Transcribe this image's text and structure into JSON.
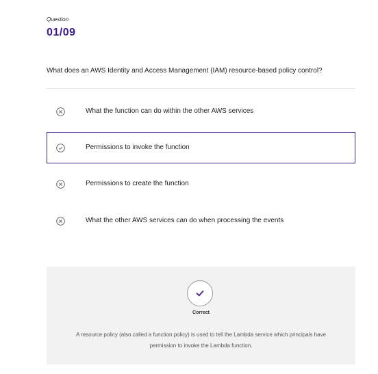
{
  "question": {
    "caption": "Question",
    "number": "01/09",
    "text": "What does an AWS Identity and Access Management (IAM) resource-based policy control?"
  },
  "options": [
    {
      "label": "What the function can do within the other AWS services",
      "icon": "x-circle-icon",
      "selected": false
    },
    {
      "label": "Permissions to invoke the function",
      "icon": "check-circle-icon",
      "selected": true
    },
    {
      "label": "Permissions to create the function",
      "icon": "x-circle-icon",
      "selected": false
    },
    {
      "label": "What the other AWS services can do when processing the events",
      "icon": "x-circle-icon",
      "selected": false
    }
  ],
  "feedback": {
    "icon": "checkmark-icon",
    "status": "Correct",
    "explanation": "A resource policy (also called a function policy) is used to tell the Lambda service which principals have permission to invoke the Lambda function."
  },
  "colors": {
    "accent": "#3d1a8c",
    "feedback_bg": "#f2f2f2",
    "divider": "#e6e6e6"
  }
}
